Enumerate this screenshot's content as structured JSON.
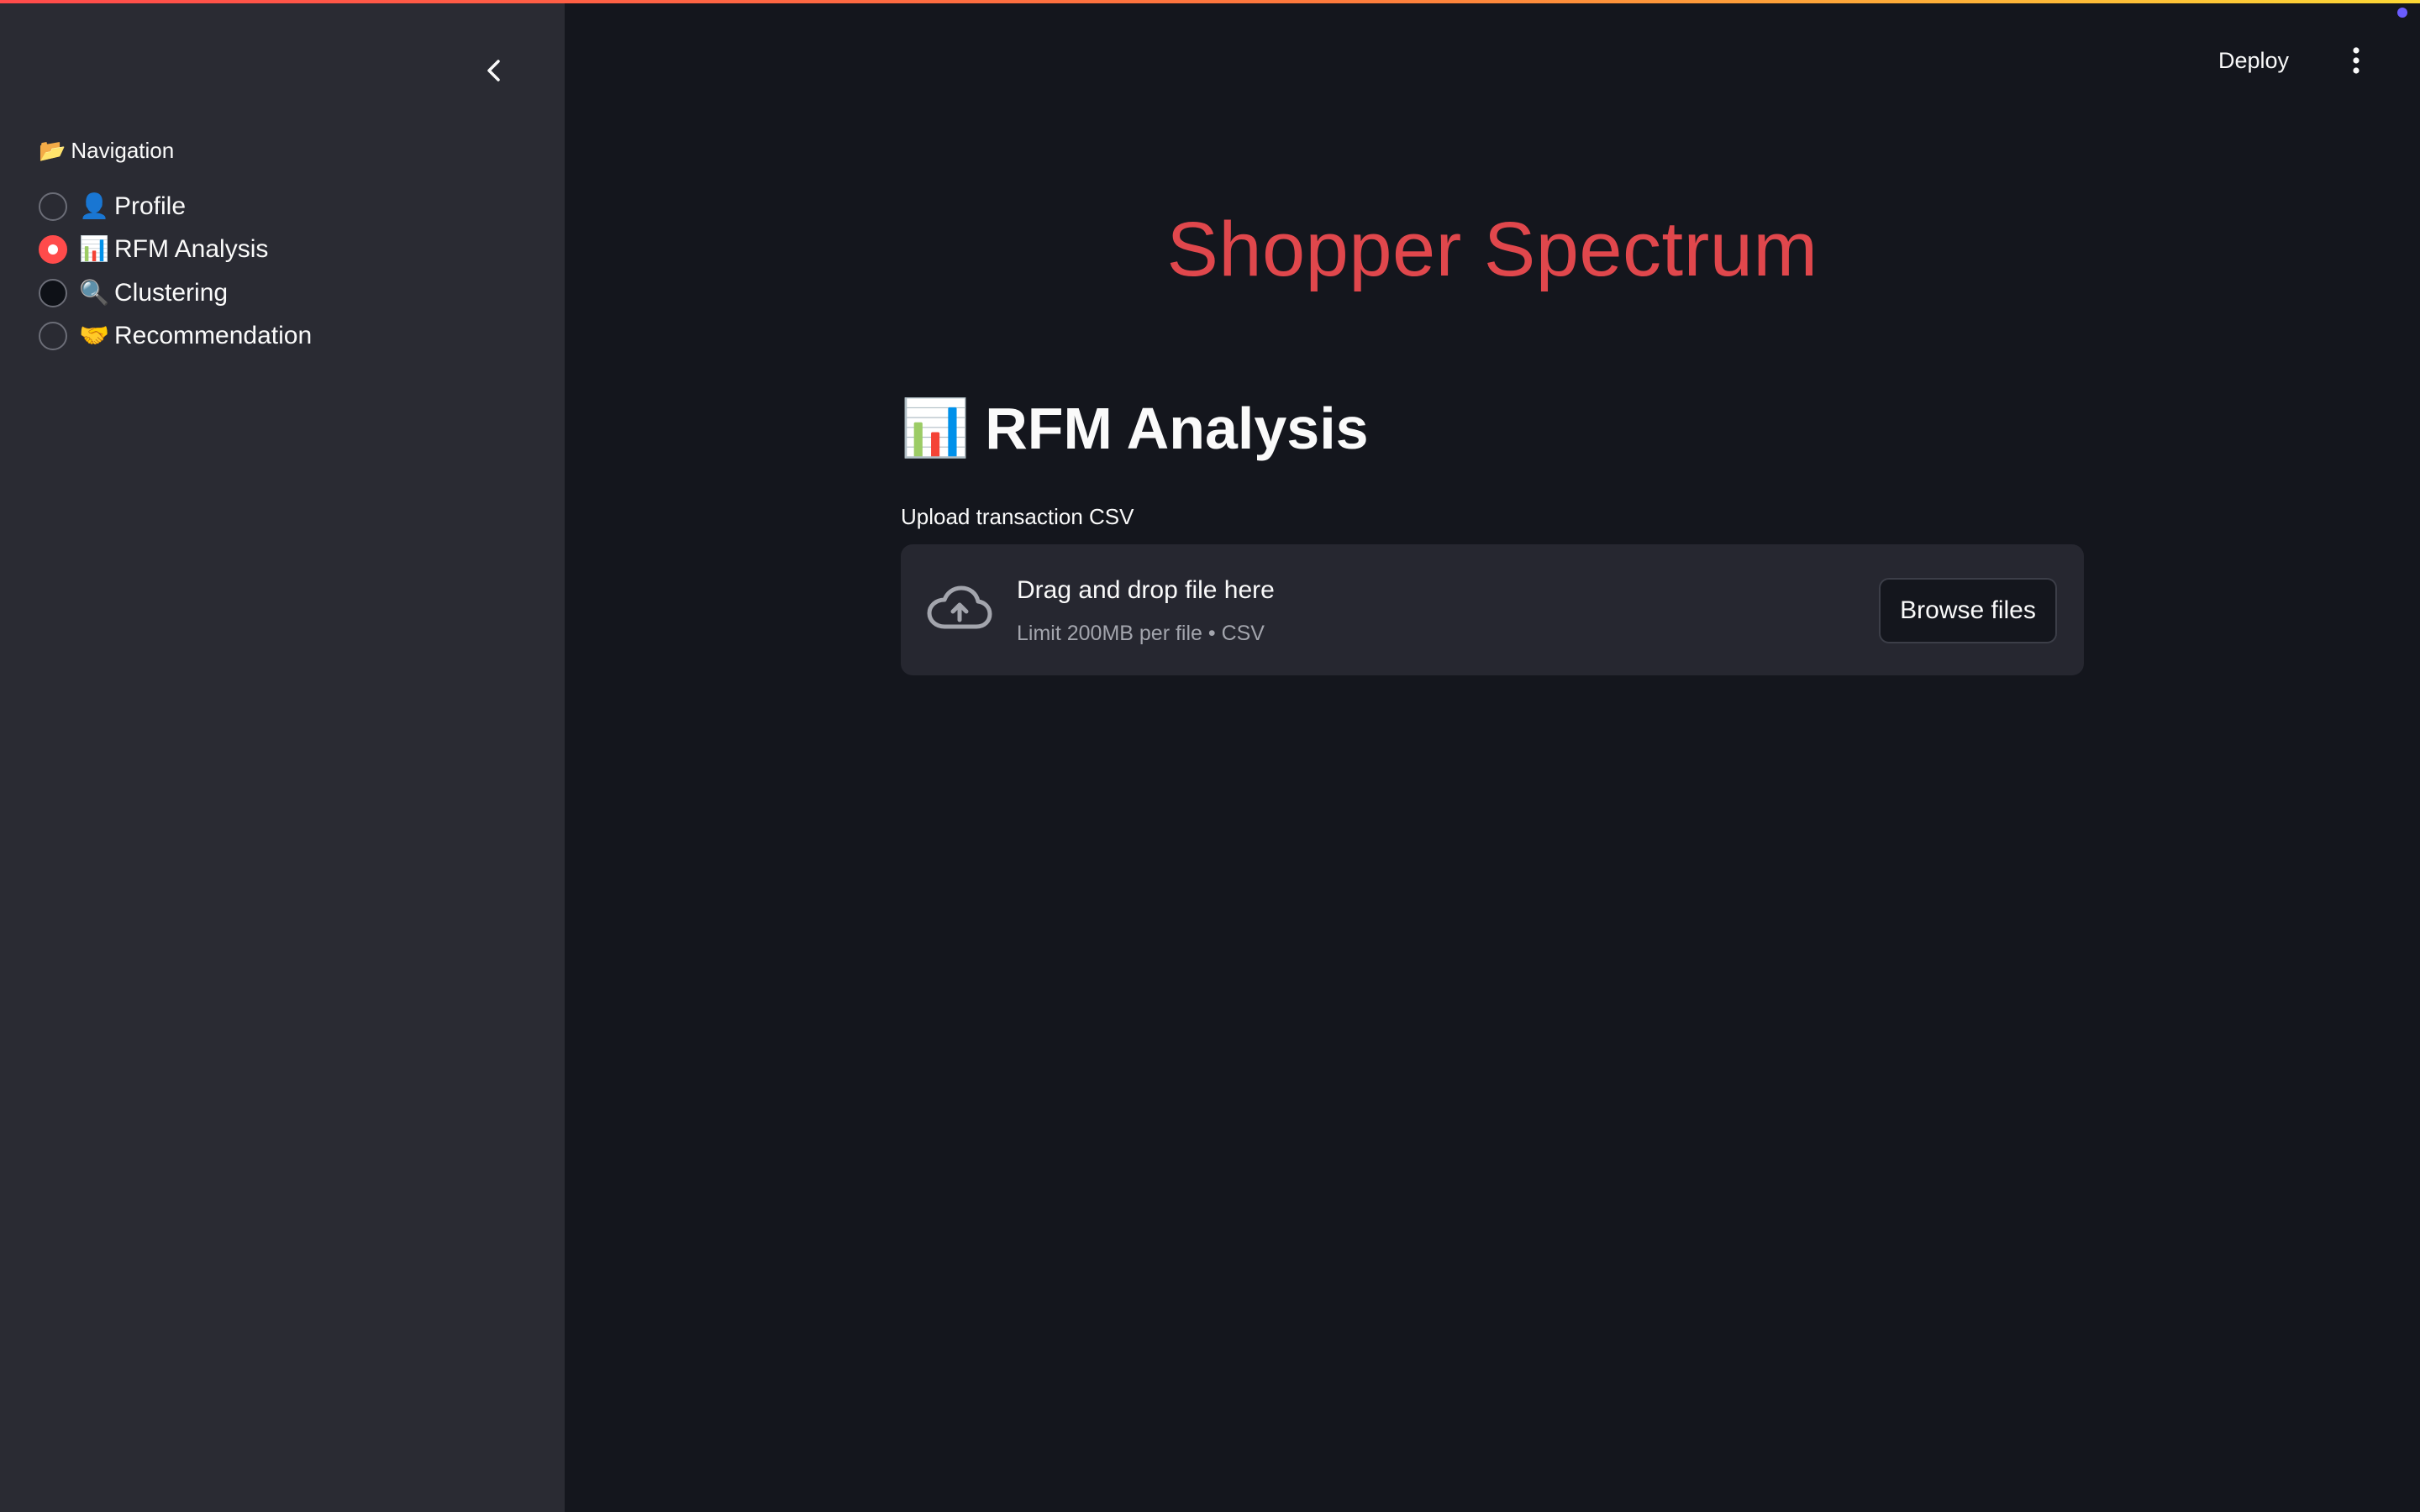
{
  "theme": {
    "accent": "#ff4b4b",
    "title_color": "#e0474c",
    "background": "#14161d",
    "sidebar_bg": "#2a2b33"
  },
  "sidebar": {
    "collapse_icon": "chevron-left-icon",
    "nav_heading": {
      "emoji": "📂",
      "text": "Navigation"
    },
    "items": [
      {
        "emoji": "👤",
        "label": "Profile",
        "selected": false
      },
      {
        "emoji": "📊",
        "label": "RFM Analysis",
        "selected": true
      },
      {
        "emoji": "🔍",
        "label": "Clustering",
        "selected": false
      },
      {
        "emoji": "🤝",
        "label": "Recommendation",
        "selected": false
      }
    ]
  },
  "header": {
    "deploy_label": "Deploy",
    "menu_icon": "kebab-menu-icon"
  },
  "main": {
    "title": "Shopper Spectrum",
    "section": {
      "emoji": "📊",
      "heading": "RFM Analysis"
    },
    "uploader": {
      "label": "Upload transaction CSV",
      "icon": "cloud-upload-icon",
      "drop_text": "Drag and drop file here",
      "limit_text": "Limit 200MB per file • CSV",
      "button_label": "Browse files"
    }
  }
}
